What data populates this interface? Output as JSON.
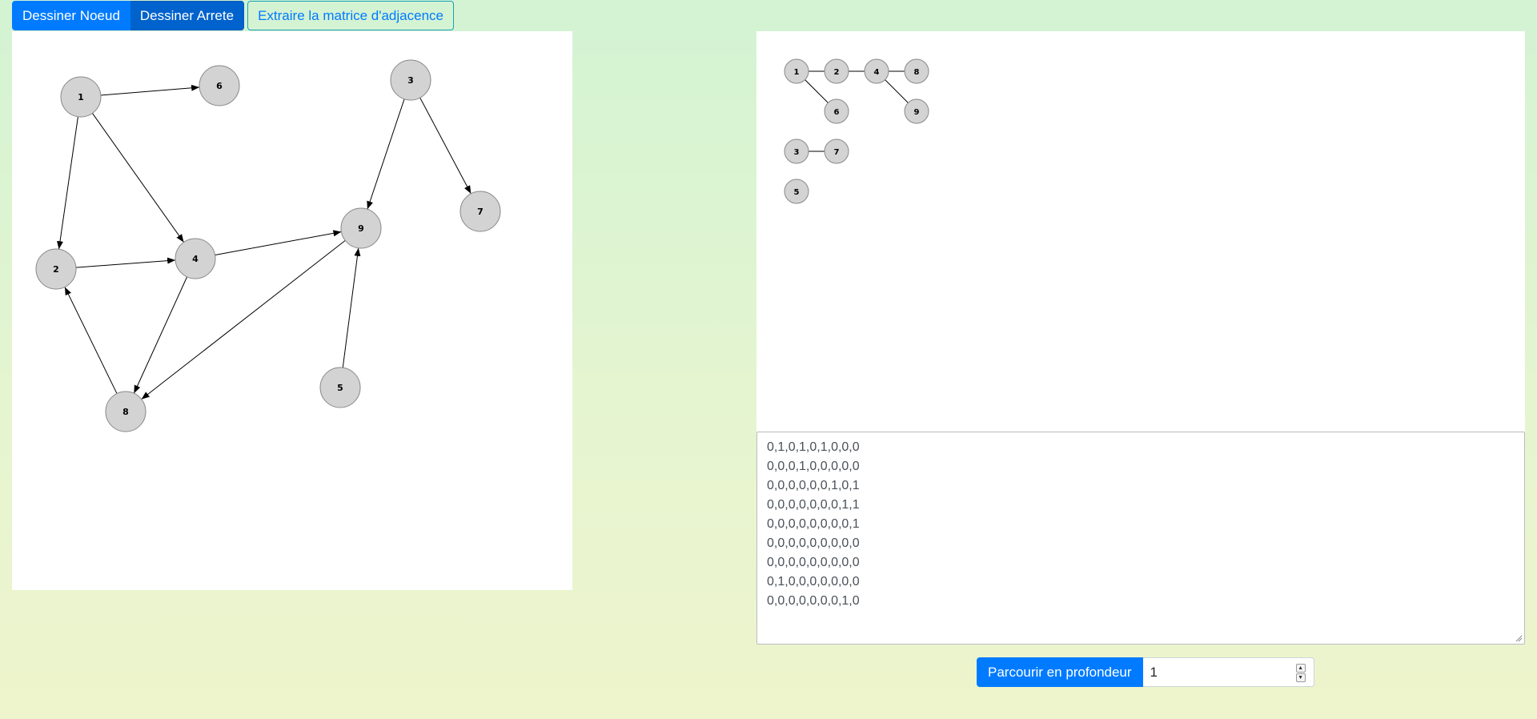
{
  "toolbar": {
    "draw_node_label": "Dessiner Noeud",
    "draw_edge_label": "Dessiner Arrete",
    "extract_matrix_label": "Extraire la matrice d'adjacence"
  },
  "directed_graph": {
    "nodes": [
      "1",
      "2",
      "3",
      "4",
      "5",
      "6",
      "7",
      "8",
      "9"
    ],
    "edges": [
      [
        "1",
        "6"
      ],
      [
        "1",
        "2"
      ],
      [
        "1",
        "4"
      ],
      [
        "2",
        "4"
      ],
      [
        "3",
        "9"
      ],
      [
        "3",
        "7"
      ],
      [
        "4",
        "9"
      ],
      [
        "4",
        "8"
      ],
      [
        "9",
        "8"
      ],
      [
        "5",
        "9"
      ],
      [
        "8",
        "2"
      ]
    ]
  },
  "dfs_forest": {
    "nodes": [
      "1",
      "2",
      "4",
      "8",
      "6",
      "9",
      "3",
      "7",
      "5"
    ],
    "edges": [
      [
        "1",
        "2"
      ],
      [
        "2",
        "4"
      ],
      [
        "4",
        "8"
      ],
      [
        "1",
        "6"
      ],
      [
        "4",
        "9"
      ],
      [
        "3",
        "7"
      ]
    ]
  },
  "adjacency_matrix": [
    "0,1,0,1,0,1,0,0,0",
    "0,0,0,1,0,0,0,0,0",
    "0,0,0,0,0,0,1,0,1",
    "0,0,0,0,0,0,0,1,1",
    "0,0,0,0,0,0,0,0,1",
    "0,0,0,0,0,0,0,0,0",
    "0,0,0,0,0,0,0,0,0",
    "0,1,0,0,0,0,0,0,0",
    "0,0,0,0,0,0,0,1,0"
  ],
  "dfs_controls": {
    "button_label": "Parcourir en profondeur",
    "start_node_value": "1",
    "spin_up": "▲",
    "spin_down": "▼"
  }
}
